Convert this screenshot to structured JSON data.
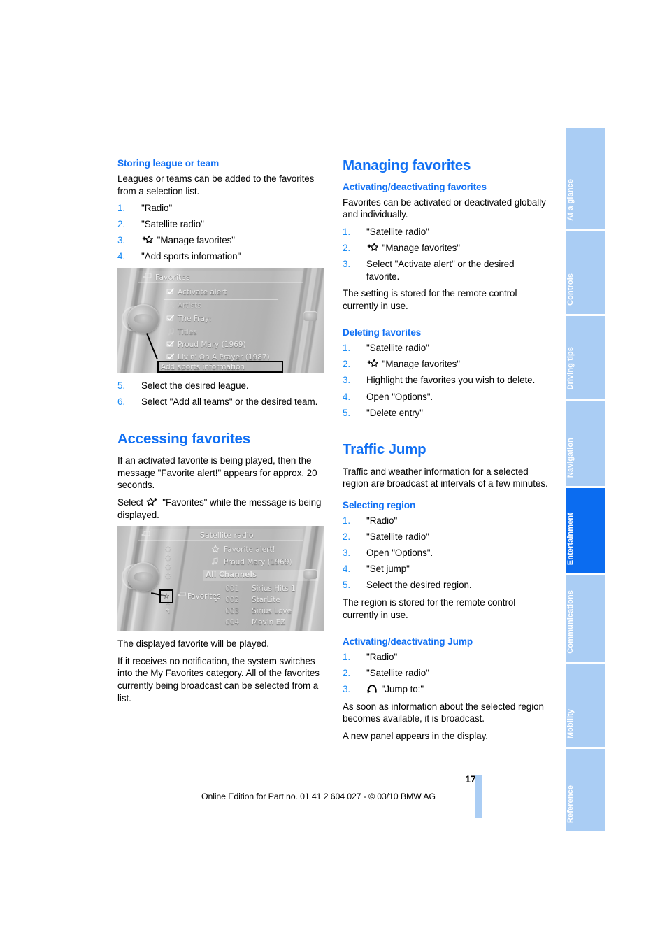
{
  "page": {
    "number": "177",
    "edition_note": "Online Edition for Part no. 01 41 2 604 027 - © 03/10 BMW AG",
    "accent_blue": "#1170f4",
    "step_blue": "#1a8cf5",
    "tab_blue": "#aacdf4",
    "tab_active_blue": "#0b6cf0"
  },
  "left_column": {
    "storing": {
      "heading": "Storing league or team",
      "intro": "Leagues or teams can be added to the favorites from a selection list.",
      "steps": [
        {
          "num": "1.",
          "text": "\"Radio\""
        },
        {
          "num": "2.",
          "text": "\"Satellite radio\""
        },
        {
          "num": "3.",
          "icon": "add-favorite-star-icon",
          "text": "\"Manage favorites\""
        },
        {
          "num": "4.",
          "text": "\"Add sports information\""
        }
      ],
      "steps_after": [
        {
          "num": "5.",
          "text": "Select the desired league."
        },
        {
          "num": "6.",
          "text": "Select \"Add all teams\" or the desired team."
        }
      ]
    },
    "figure_favorites": {
      "caption_icon": "idrive-display-icon",
      "title": "Favorites",
      "rows": [
        {
          "icon": "checkbox-checked-icon",
          "label": "Activate alert"
        },
        {
          "icon": "artist-icon",
          "label": "Artists"
        },
        {
          "icon": "checkbox-checked-icon",
          "label": "The Fray;"
        },
        {
          "icon": "note-icon",
          "label": "Titles"
        },
        {
          "icon": "checkbox-checked-icon",
          "label": "Proud Mary (1969)"
        },
        {
          "icon": "checkbox-checked-icon",
          "label": "Livin' On A Prayer (1987)"
        }
      ],
      "selected_item": "Add sports information"
    },
    "accessing": {
      "heading": "Accessing favorites",
      "paragraph_1": "If an activated favorite is being played, then the message \"Favorite alert!\" appears for approx. 20 seconds.",
      "paragraph_2_before": "Select",
      "paragraph_2_icon": "favorites-star-icon",
      "paragraph_2_after": "\"Favorites\" while the message is being displayed."
    },
    "figure_satellite": {
      "title": "Satellite radio",
      "alert_rows": [
        {
          "icon": "star-icon",
          "label": "Favorite alert!"
        },
        {
          "icon": "note-icon",
          "label": "Proud Mary (1969)"
        }
      ],
      "section_header": "All Channels",
      "channels": [
        {
          "check": "",
          "number": "001",
          "name": "Sirius Hits 1"
        },
        {
          "check": "✓",
          "number": "002",
          "name": "StarLite"
        },
        {
          "check": "",
          "number": "003",
          "name": "Sirius Love"
        },
        {
          "check": "",
          "number": "004",
          "name": "Movin EZ"
        }
      ],
      "tooltip": "Favorites"
    },
    "closing": {
      "paragraph_1": "The displayed favorite will be played.",
      "paragraph_2": "If it receives no notification, the system switches into the My Favorites category. All of the favorites currently being broadcast can be selected from a list."
    }
  },
  "right_column": {
    "managing": {
      "heading": "Managing favorites",
      "activating": {
        "heading": "Activating/deactivating favorites",
        "intro": "Favorites can be activated or deactivated globally and individually.",
        "steps": [
          {
            "num": "1.",
            "text": "\"Satellite radio\""
          },
          {
            "num": "2.",
            "icon": "add-favorite-star-icon",
            "text": "\"Manage favorites\""
          },
          {
            "num": "3.",
            "text": "Select \"Activate alert\" or the desired favorite."
          }
        ],
        "note": "The setting is stored for the remote control currently in use."
      },
      "deleting": {
        "heading": "Deleting favorites",
        "steps": [
          {
            "num": "1.",
            "text": "\"Satellite radio\""
          },
          {
            "num": "2.",
            "icon": "add-favorite-star-icon",
            "text": "\"Manage favorites\""
          },
          {
            "num": "3.",
            "text": "Highlight the favorites you wish to delete."
          },
          {
            "num": "4.",
            "text": "Open \"Options\"."
          },
          {
            "num": "5.",
            "text": "\"Delete entry\""
          }
        ]
      }
    },
    "traffic_jump": {
      "heading": "Traffic Jump",
      "intro": "Traffic and weather information for a selected region are broadcast at intervals of a few minutes.",
      "selecting_region": {
        "heading": "Selecting region",
        "steps": [
          {
            "num": "1.",
            "text": "\"Radio\""
          },
          {
            "num": "2.",
            "text": "\"Satellite radio\""
          },
          {
            "num": "3.",
            "text": "Open \"Options\"."
          },
          {
            "num": "4.",
            "text": "\"Set jump\""
          },
          {
            "num": "5.",
            "text": "Select the desired region."
          }
        ],
        "note": "The region is stored for the remote control currently in use."
      },
      "activating_jump": {
        "heading": "Activating/deactivating Jump",
        "steps": [
          {
            "num": "1.",
            "text": "\"Radio\""
          },
          {
            "num": "2.",
            "text": "\"Satellite radio\""
          },
          {
            "num": "3.",
            "icon": "jump-arc-icon",
            "text": "\"Jump to:\""
          }
        ],
        "note_1": "As soon as information about the selected region becomes available, it is broadcast.",
        "note_2": "A new panel appears in the display."
      }
    }
  },
  "rail": {
    "tabs": [
      {
        "label": "At a glance",
        "active": false
      },
      {
        "label": "Controls",
        "active": false
      },
      {
        "label": "Driving tips",
        "active": false
      },
      {
        "label": "Navigation",
        "active": false
      },
      {
        "label": "Entertainment",
        "active": true
      },
      {
        "label": "Communications",
        "active": false
      },
      {
        "label": "Mobility",
        "active": false
      },
      {
        "label": "Reference",
        "active": false
      }
    ]
  }
}
